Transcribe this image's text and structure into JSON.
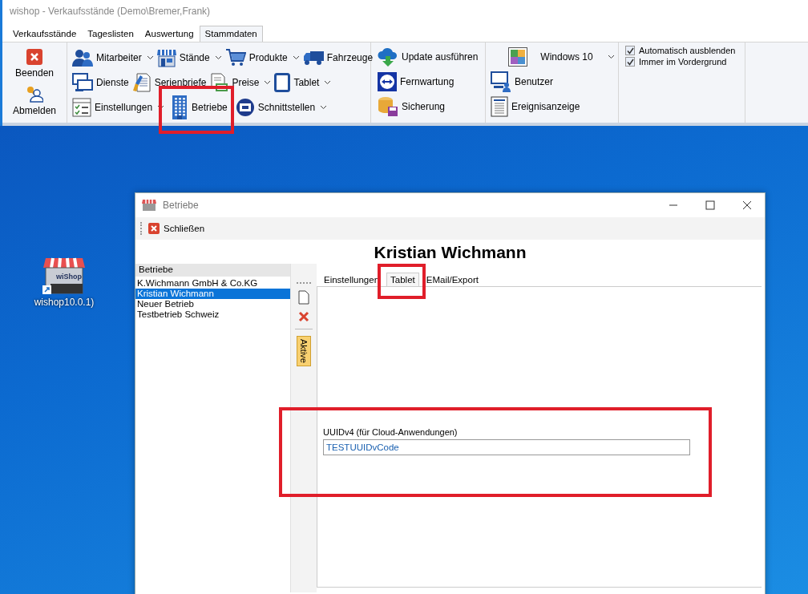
{
  "app_window": {
    "title": "wishop - Verkaufsstände (Demo\\Bremer,Frank)"
  },
  "ribbon_tabs": [
    {
      "label": "Verkaufsstände",
      "selected": false
    },
    {
      "label": "Tageslisten",
      "selected": false
    },
    {
      "label": "Auswertung",
      "selected": false
    },
    {
      "label": "Stammdaten",
      "selected": true
    }
  ],
  "ribbon": {
    "session_group": {
      "items": [
        {
          "label": "Beenden"
        },
        {
          "label": "Abmelden"
        }
      ]
    },
    "master_data_group": {
      "rows": [
        [
          {
            "label": "Mitarbeiter",
            "dropdown": true
          },
          {
            "label": "Stände",
            "dropdown": true
          },
          {
            "label": "Produkte",
            "dropdown": true
          },
          {
            "label": "Fahrzeuge",
            "dropdown": false
          }
        ],
        [
          {
            "label": "Dienste",
            "dropdown": false
          },
          {
            "label": "Serienbriefe",
            "dropdown": false
          },
          {
            "label": "Preise",
            "dropdown": true
          },
          {
            "label": "Tablet",
            "dropdown": true
          }
        ],
        [
          {
            "label": "Einstellungen",
            "dropdown": true
          },
          {
            "label": "Betriebe",
            "dropdown": false
          },
          {
            "label": "Schnittstellen",
            "dropdown": true
          }
        ]
      ]
    },
    "maintenance_group": {
      "items": [
        {
          "label": "Update ausführen"
        },
        {
          "label": "Fernwartung"
        },
        {
          "label": "Sicherung"
        }
      ]
    },
    "system_group": {
      "theme_dropdown": "Windows 10",
      "items": [
        {
          "label": "Benutzer"
        },
        {
          "label": "Ereignisanzeige"
        }
      ]
    },
    "options_group": {
      "items": [
        {
          "label": "Automatisch ausblenden",
          "checked": true
        },
        {
          "label": "Immer im Vordergrund",
          "checked": true
        }
      ]
    }
  },
  "desktop_icons": [
    {
      "label": "wishop10.0.1)",
      "logo_text": "wiShop"
    }
  ],
  "dialog": {
    "title": "Betriebe",
    "toolbar": [
      {
        "label": "Schließen"
      }
    ],
    "heading": "Kristian Wichmann",
    "list": {
      "header": "Betriebe",
      "items": [
        {
          "label": "K.Wichmann GmbH & Co.KG",
          "selected": false
        },
        {
          "label": "Kristian Wichmann",
          "selected": true
        },
        {
          "label": "Neuer Betrieb",
          "selected": false
        },
        {
          "label": "Testbetrieb Schweiz",
          "selected": false
        }
      ]
    },
    "side_toolbar": {
      "active_button": "Aktive"
    },
    "tabs": [
      {
        "label": "Einstellungen",
        "selected": false
      },
      {
        "label": "Tablet",
        "selected": true
      },
      {
        "label": "EMail/Export",
        "selected": false
      }
    ],
    "field": {
      "label": "UUIDv4 (für Cloud-Anwendungen)",
      "value": "TESTUUIDvCode"
    }
  }
}
